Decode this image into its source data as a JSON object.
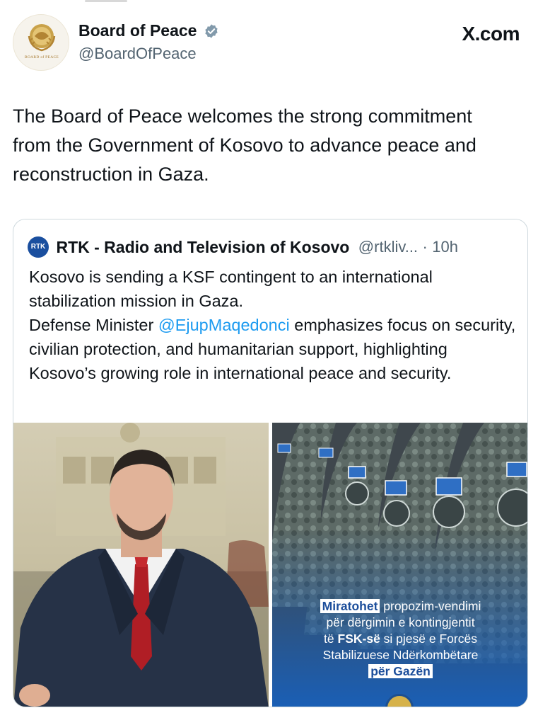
{
  "header": {
    "display_name": "Board of Peace",
    "handle": "@BoardOfPeace",
    "site_label": "X.com",
    "avatar_caption": "BOARD of PEACE",
    "verified_icon": "verified-badge-icon"
  },
  "tweet": {
    "text": "The Board of Peace welcomes the strong commitment from the Government of Kosovo to advance peace and reconstruction in Gaza."
  },
  "quote": {
    "logo": "RTK",
    "name": "RTK - Radio and Television of Kosovo",
    "handle": "@rtkliv...",
    "separator": "·",
    "time": "10h",
    "line1": "Kosovo is sending a KSF contingent to an international stabilization mission in Gaza.",
    "line2_prefix": "Defense Minister ",
    "mention": "@EjupMaqedonci",
    "line2_suffix": " emphasizes focus on security, civilian protection, and humanitarian support, highlighting Kosovo’s growing role in international peace and security."
  },
  "media": {
    "right_caption": {
      "hl1": "Miratohet",
      "t1": " propozim-vendimi",
      "t2": "për dërgimin e kontingjentit",
      "t3a": "të ",
      "bold": "FSK-së",
      "t3b": " si pjesë e Forcës",
      "t4": "Stabilizuese Ndërkombëtare",
      "hl2": "për Gazën"
    }
  },
  "colors": {
    "text": "#0f1419",
    "muted": "#536471",
    "link": "#1d9bf0",
    "verified": "#829aab",
    "caption_bg": "#1a5fb6"
  }
}
